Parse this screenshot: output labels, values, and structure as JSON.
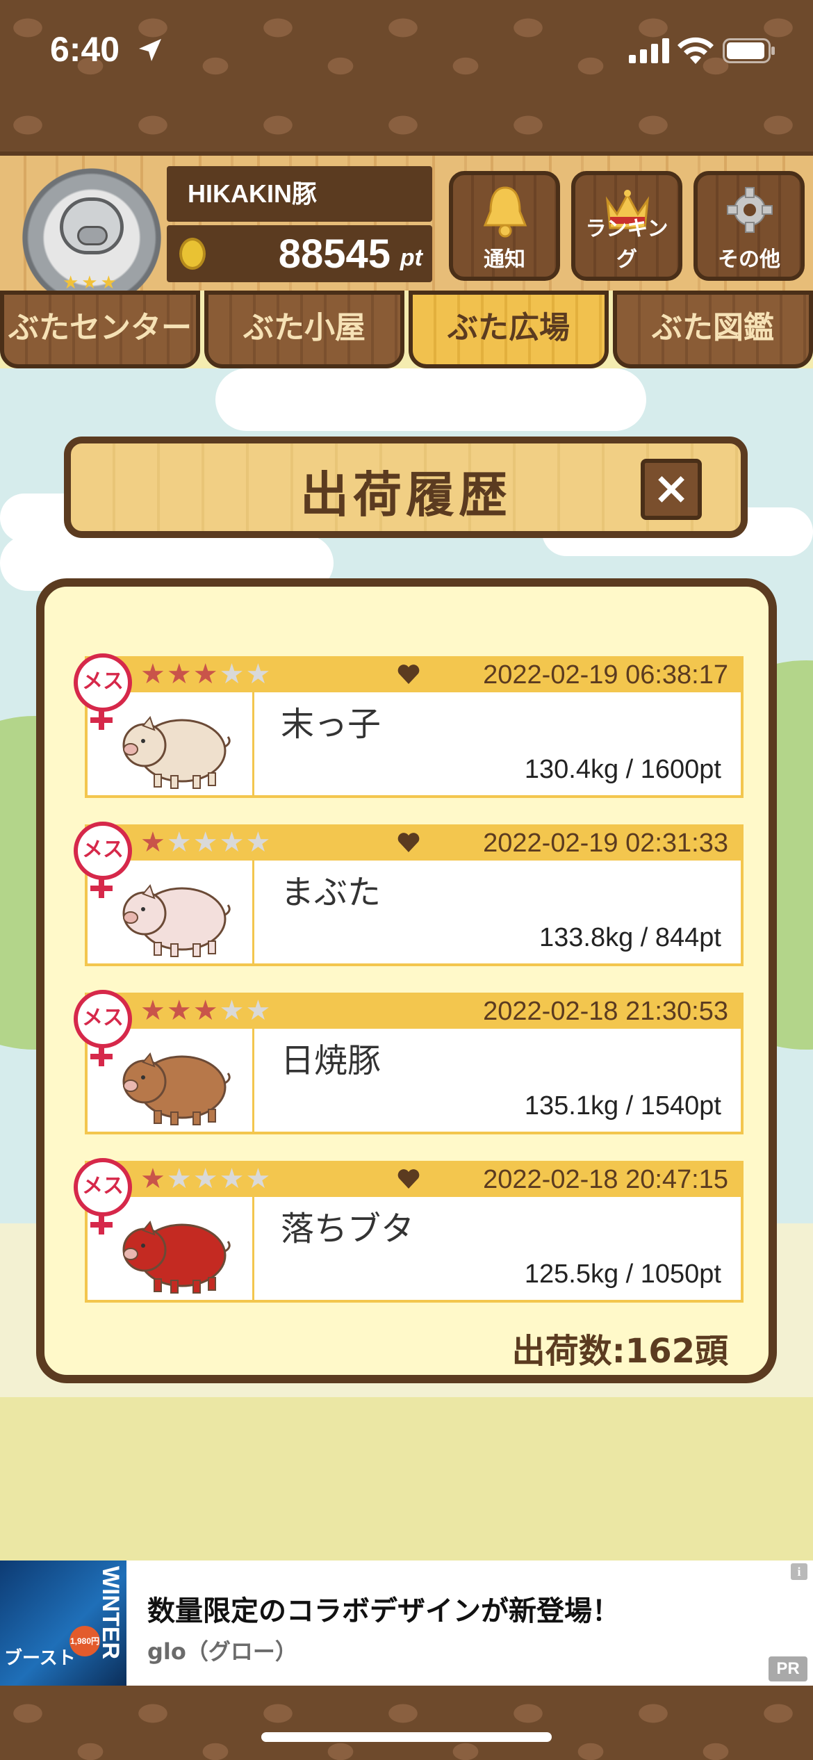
{
  "status_bar": {
    "time": "6:40"
  },
  "header": {
    "username": "HIKAKIN豚",
    "points": "88545",
    "points_unit": "pt",
    "buttons": [
      {
        "label": "通知",
        "icon": "bell-icon"
      },
      {
        "label": "ランキング",
        "icon": "crown-icon"
      },
      {
        "label": "その他",
        "icon": "gear-icon"
      }
    ]
  },
  "tabs": [
    {
      "label": "ぶたセンター",
      "active": false
    },
    {
      "label": "ぶた小屋",
      "active": false
    },
    {
      "label": "ぶた広場",
      "active": true
    },
    {
      "label": "ぶた図鑑",
      "active": false
    }
  ],
  "dialog": {
    "title": "出荷履歴",
    "close_label": "×",
    "records": [
      {
        "sex": "メス",
        "stars": 3,
        "favorite": true,
        "date": "2022-02-19 06:38:17",
        "name": "末っ子",
        "stats": "130.4kg / 1600pt",
        "pig_color": "#efe0cd",
        "pig_icon": "pig-sprout-icon"
      },
      {
        "sex": "メス",
        "stars": 1,
        "favorite": true,
        "date": "2022-02-19 02:31:33",
        "name": "まぶた",
        "stats": "133.8kg / 844pt",
        "pig_color": "#f3dfdc",
        "pig_icon": "pig-icon"
      },
      {
        "sex": "メス",
        "stars": 3,
        "favorite": false,
        "date": "2022-02-18 21:30:53",
        "name": "日焼豚",
        "stats": "135.1kg / 1540pt",
        "pig_color": "#b7784a",
        "pig_icon": "pig-tan-icon"
      },
      {
        "sex": "メス",
        "stars": 1,
        "favorite": true,
        "date": "2022-02-18 20:47:15",
        "name": "落ちブタ",
        "stats": "125.5kg / 1050pt",
        "pig_color": "#c42a22",
        "pig_icon": "pig-ninja-icon"
      }
    ],
    "total": "出荷数:162頭"
  },
  "ad": {
    "title": "数量限定のコラボデザインが新登場！",
    "sponsor": "glo（グロー）",
    "pr_label": "PR",
    "info_label": "i",
    "image_text_vertical": "WINTER",
    "image_text": "ブースト",
    "image_price": "1,980円"
  },
  "colors": {
    "brown": "#5b3b20",
    "gold": "#f3c64e",
    "panel": "#fff9c9",
    "female": "#d6284a"
  }
}
